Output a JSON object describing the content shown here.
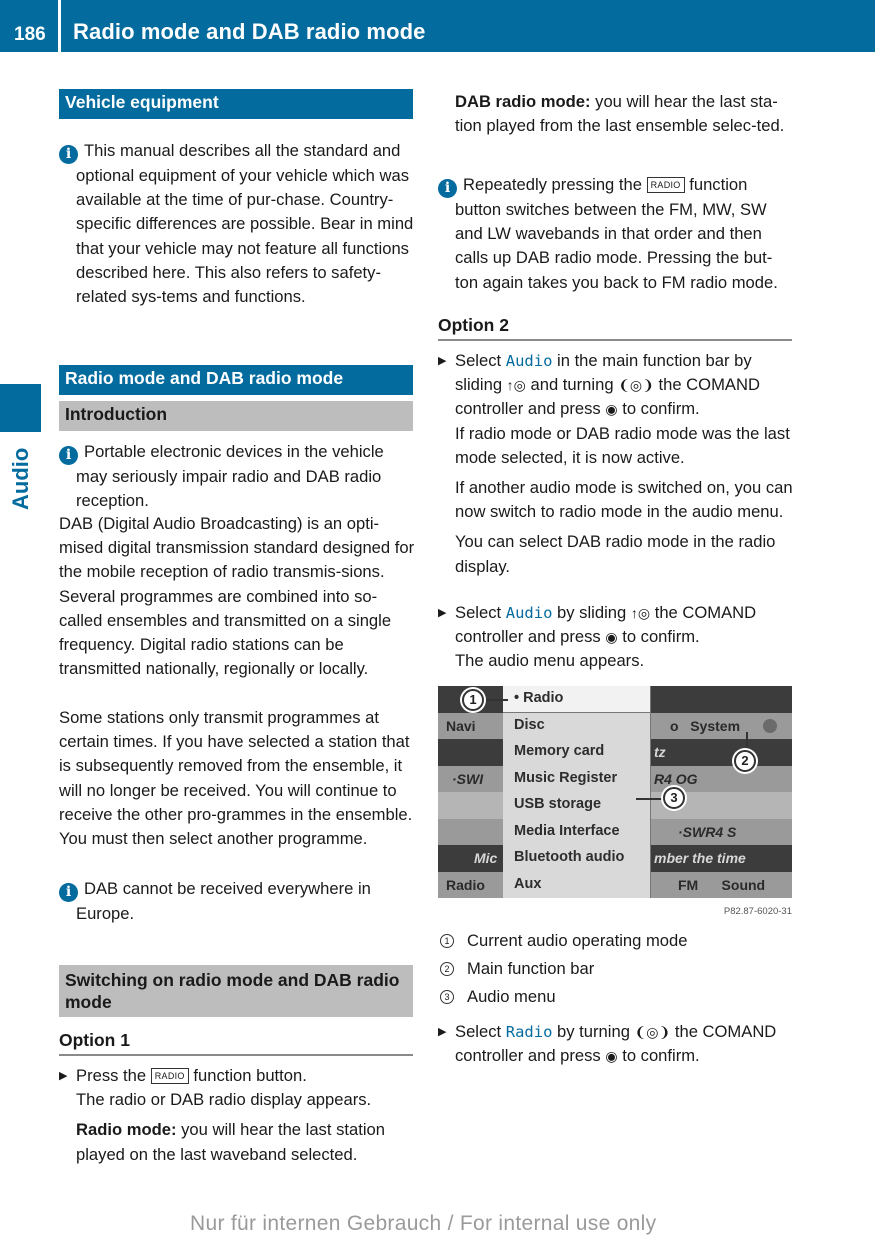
{
  "header": {
    "page_number": "186",
    "title": "Radio mode and DAB radio mode"
  },
  "side_tab": {
    "label": "Audio"
  },
  "left": {
    "vehicle_equipment": {
      "heading": "Vehicle equipment",
      "info": "This manual describes all the standard and optional equipment of your vehicle which was available at the time of pur-chase. Country-specific differences are possible. Bear in mind that your vehicle may not feature all functions described here. This also refers to safety-related sys-tems and functions."
    },
    "section_heading": "Radio mode and DAB radio mode",
    "introduction": {
      "heading": "Introduction",
      "info": "Portable electronic devices in the vehicle may seriously impair radio and DAB radio reception.",
      "para1": "DAB (Digital Audio Broadcasting) is an opti-mised digital transmission standard designed for the mobile reception of radio transmis-sions. Several programmes are combined into so-called ensembles and transmitted on a single frequency. Digital radio stations can be transmitted nationally, regionally or locally.",
      "para2": "Some stations only transmit programmes at certain times. If you have selected a station that is subsequently removed from the ensemble, it will no longer be received. You will continue to receive the other pro-grammes in the ensemble. You must then select another programme.",
      "info2": "DAB cannot be received everywhere in Europe."
    },
    "switching": {
      "heading": "Switching on radio mode and DAB radio mode",
      "option1": "Option 1",
      "step1_pre": "Press the",
      "step1_key": "RADIO",
      "step1_post": "function button.",
      "step1_result": "The radio or DAB radio display appears.",
      "radio_mode_label": "Radio mode:",
      "radio_mode_text": "you will hear the last station played on the last waveband selected."
    }
  },
  "right": {
    "dab_mode_label": "DAB radio mode:",
    "dab_mode_text": "you will hear the last sta-tion played from the last ensemble selec-ted.",
    "info_pre": "Repeatedly pressing the",
    "info_key": "RADIO",
    "info_post": "function button switches between the FM, MW, SW and LW wavebands in that order and then calls up DAB radio mode. Pressing the but-ton again takes you back to FM radio mode.",
    "option2": "Option 2",
    "step_a": {
      "pre": "Select",
      "ui": "Audio",
      "mid1": "in the main function bar by sliding",
      "slide_sym": "↑◎",
      "mid2": "and turning",
      "turn_sym": "❨◎❩",
      "mid3": "the COMAND controller and press",
      "press_sym": "◉",
      "post": "to confirm.",
      "r1": "If radio mode or DAB radio mode was the last mode selected, it is now active.",
      "r2": "If another audio mode is switched on, you can now switch to radio mode in the audio menu.",
      "r3": "You can select DAB radio mode in the radio display."
    },
    "step_b": {
      "pre": "Select",
      "ui": "Audio",
      "mid1": "by sliding",
      "slide_sym": "↑◎",
      "mid2": "the COMAND controller and press",
      "press_sym": "◉",
      "post": "to confirm.",
      "r1": "The audio menu appears."
    },
    "figure": {
      "menu_items": [
        "Radio",
        "Disc",
        "Memory card",
        "Music Register",
        "USB storage",
        "Media Interface",
        "Bluetooth audio",
        "Aux"
      ],
      "bg_left": [
        "",
        "Navi",
        "",
        "·SWI",
        "",
        "",
        "Mic",
        "Radio"
      ],
      "bg_right": [
        "",
        "o   System",
        "tz",
        "R4 OG",
        "",
        "·SWR4 S",
        "mber the time",
        "FM      Sound"
      ],
      "callouts": [
        "1",
        "2",
        "3"
      ],
      "code": "P82.87-6020-31"
    },
    "legend": [
      {
        "num": "1",
        "text": "Current audio operating mode"
      },
      {
        "num": "2",
        "text": "Main function bar"
      },
      {
        "num": "3",
        "text": "Audio menu"
      }
    ],
    "step_c": {
      "pre": "Select",
      "ui": "Radio",
      "mid1": "by turning",
      "turn_sym": "❨◎❩",
      "mid2": "the COMAND controller and press",
      "press_sym": "◉",
      "post": "to confirm."
    }
  },
  "footer": {
    "watermark": "Nur für internen Gebrauch / For internal use only"
  }
}
